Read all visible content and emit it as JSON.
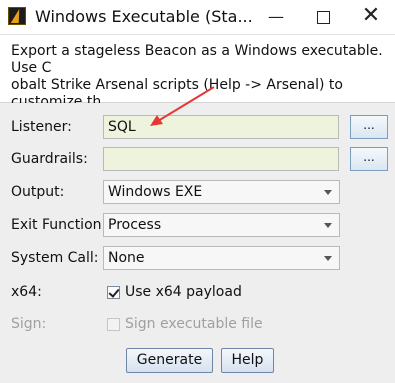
{
  "window": {
    "title": "Windows Executable (Sta...",
    "minimize_glyph": "—",
    "close_glyph": "✕"
  },
  "description": "Export a stageless Beacon as a Windows executable. Use C\nobalt Strike Arsenal scripts (Help -> Arsenal) to customize th\nis process.",
  "form": {
    "listener": {
      "label": "Listener:",
      "value": "SQL",
      "button": "..."
    },
    "guardrails": {
      "label": "Guardrails:",
      "value": "",
      "button": "..."
    },
    "output": {
      "label": "Output:",
      "value": "Windows EXE"
    },
    "exit_function": {
      "label": "Exit Function:",
      "value": "Process"
    },
    "system_call": {
      "label": "System Call:",
      "value": "None"
    },
    "x64": {
      "label": "x64:",
      "checkbox_label": "Use x64 payload",
      "checked": true
    },
    "sign": {
      "label": "Sign:",
      "checkbox_label": "Sign executable file",
      "checked": false,
      "enabled": false
    }
  },
  "buttons": {
    "generate": "Generate",
    "help": "Help"
  },
  "colors": {
    "annotation_arrow": "#e53935",
    "field_background": "#eef3dd",
    "panel_background": "#eeeeee"
  },
  "icons": {
    "app": "cobalt-strike-icon",
    "maximize": "maximize-icon",
    "dropdown": "chevron-down-icon"
  }
}
